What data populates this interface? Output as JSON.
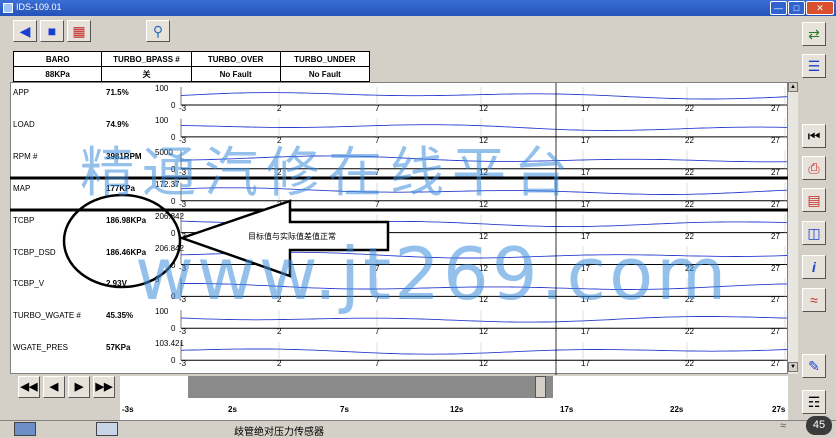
{
  "window": {
    "title": "IDS-109.01"
  },
  "header": {
    "columns": [
      {
        "name": "BARO",
        "value": "88KPa"
      },
      {
        "name": "TURBO_BPASS #",
        "value": "关"
      },
      {
        "name": "TURBO_OVER",
        "value": "No Fault"
      },
      {
        "name": "TURBO_UNDER",
        "value": "No Fault"
      }
    ]
  },
  "x_ticks": [
    "-3",
    "2",
    "7",
    "12",
    "17",
    "22",
    "27"
  ],
  "params": [
    {
      "name": "APP",
      "value": "71.5%",
      "ymax": "100",
      "ymin": "0"
    },
    {
      "name": "LOAD",
      "value": "74.9%",
      "ymax": "100",
      "ymin": "0"
    },
    {
      "name": "RPM #",
      "value": "3981RPM",
      "ymax": "5000",
      "ymin": "0"
    },
    {
      "name": "MAP",
      "value": "177KPa",
      "ymax": "172.37",
      "ymin": "0"
    },
    {
      "name": "TCBP",
      "value": "186.98KPa",
      "ymax": "206.842",
      "ymin": "0"
    },
    {
      "name": "TCBP_DSD",
      "value": "186.46KPa",
      "ymax": "206.842",
      "ymin": "0"
    },
    {
      "name": "TCBP_V",
      "value": "2.93V",
      "ymax": "5",
      "ymin": "0"
    },
    {
      "name": "TURBO_WGATE #",
      "value": "45.35%",
      "ymax": "100",
      "ymin": "0"
    },
    {
      "name": "WGATE_PRES",
      "value": "57KPa",
      "ymax": "103.421",
      "ymin": "0"
    }
  ],
  "annotation": {
    "text": "目标值与实际值差值正常"
  },
  "timeline": {
    "ticks": [
      "-3s",
      "2s",
      "7s",
      "12s",
      "17s",
      "22s",
      "27s"
    ]
  },
  "status": {
    "text": "歧管绝对压力传感器",
    "battery": "45"
  },
  "icons": {
    "back": "back-arrow-icon",
    "vehicle": "vehicle-icon",
    "toolbox": "toolbox-icon",
    "search": "search-icon",
    "exit": "exit-icon",
    "list": "list-icon",
    "rewind": "rewind-icon",
    "printer": "printer-icon",
    "record": "record-icon",
    "report": "report-icon",
    "info": "info-icon",
    "graph": "graph-icon",
    "edit": "edit-icon",
    "help": "help-icon"
  },
  "watermark": {
    "line1": "精通汽修在线平台",
    "line2": "www.jt269.com"
  }
}
